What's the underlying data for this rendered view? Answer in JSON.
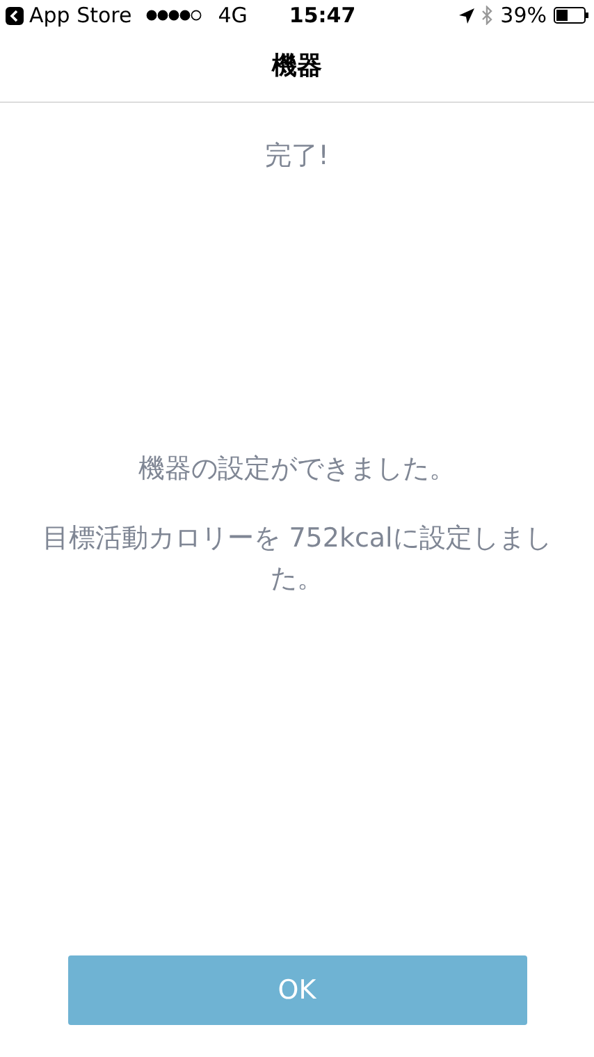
{
  "status_bar": {
    "back_app": "App Store",
    "network": "4G",
    "time": "15:47",
    "battery": "39%"
  },
  "nav": {
    "title": "機器"
  },
  "heading": "完了!",
  "messages": [
    "機器の設定ができました。",
    "目標活動カロリーを 752kcalに設定しました。"
  ],
  "button": "OK"
}
